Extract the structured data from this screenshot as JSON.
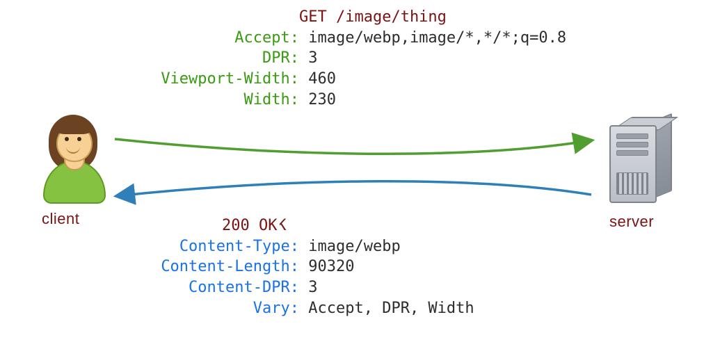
{
  "request": {
    "line": "GET /image/thing",
    "headers": [
      {
        "name": "Accept:",
        "value": "image/webp,image/*,*/*;q=0.8"
      },
      {
        "name": "DPR:",
        "value": "3"
      },
      {
        "name": "Viewport-Width:",
        "value": "460"
      },
      {
        "name": "Width:",
        "value": "230"
      }
    ]
  },
  "response": {
    "status": "200 OK",
    "headers": [
      {
        "name": "Content-Type:",
        "value": "image/webp"
      },
      {
        "name": "Content-Length:",
        "value": "90320"
      },
      {
        "name": "Content-DPR:",
        "value": "3"
      },
      {
        "name": "Vary:",
        "value": "Accept, DPR, Width"
      }
    ]
  },
  "labels": {
    "client": "client",
    "server": "server"
  },
  "colors": {
    "request_arrow": "#4f9e2f",
    "response_arrow": "#2f7fb8",
    "header_green": "#3a9a12",
    "header_blue": "#1972e6",
    "dark_red": "#7a1212"
  }
}
